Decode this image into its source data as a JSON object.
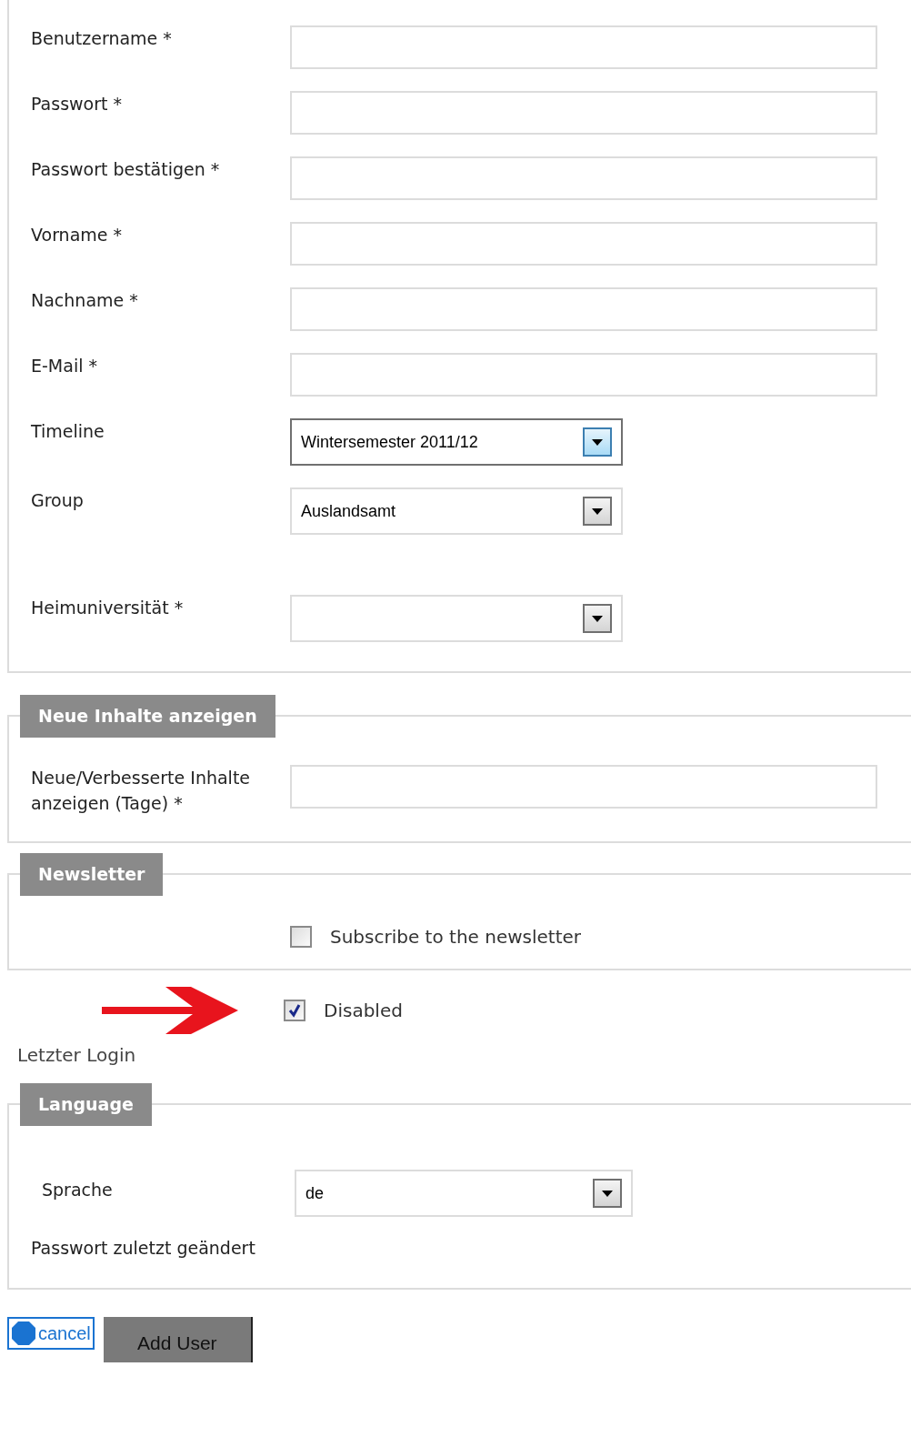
{
  "account_fields": [
    {
      "label": "Benutzername *",
      "kind": "text"
    },
    {
      "label": "Passwort *",
      "kind": "text"
    },
    {
      "label": "Passwort bestätigen *",
      "kind": "text"
    },
    {
      "label": "Vorname *",
      "kind": "text"
    },
    {
      "label": "Nachname *",
      "kind": "text"
    },
    {
      "label": "E-Mail *",
      "kind": "text"
    },
    {
      "label": "Timeline",
      "kind": "select",
      "value": "Wintersemester 2011/12",
      "focused": true
    },
    {
      "label": "Group",
      "kind": "select",
      "value": "Auslandsamt",
      "focused": false
    },
    {
      "label": "Heimuniversität *",
      "kind": "select",
      "focused": false
    }
  ],
  "content_section": {
    "legend": "Neue Inhalte anzeigen",
    "fields": [
      {
        "label": "Neue/Verbesserte Inhalte anzeigen (Tage) *",
        "kind": "text"
      }
    ]
  },
  "newsletter_section": {
    "legend": "Newsletter",
    "checkbox": {
      "label": "Subscribe to the newsletter",
      "checked": false
    }
  },
  "disabled_checkbox": {
    "label": "Disabled",
    "checked": true
  },
  "last_login_label": "Letzter Login",
  "language_section": {
    "legend": "Language",
    "fields": [
      {
        "label": "Sprache",
        "kind": "select",
        "value": "de",
        "focused": false
      },
      {
        "label": "Passwort zuletzt geändert",
        "kind": "info"
      }
    ]
  },
  "buttons": [
    {
      "label": "cancel",
      "kind": "link"
    },
    {
      "label": "Add User",
      "kind": "submit"
    }
  ]
}
